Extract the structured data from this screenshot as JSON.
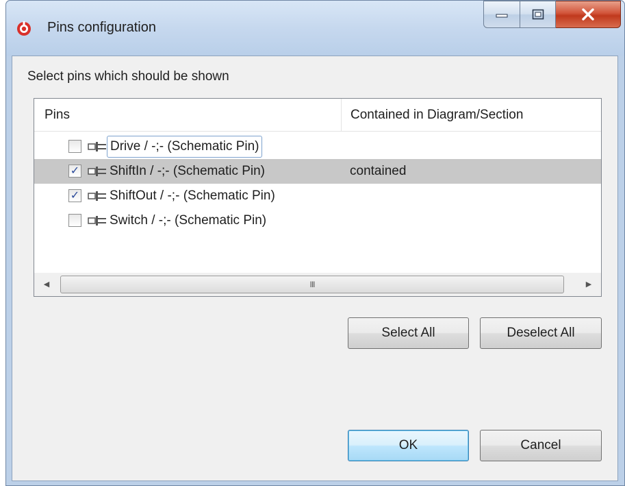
{
  "window": {
    "title": "Pins configuration"
  },
  "dialog": {
    "prompt": "Select pins which should be shown"
  },
  "table": {
    "columns": [
      "Pins",
      "Contained in Diagram/Section"
    ],
    "rows": [
      {
        "checked": false,
        "label": "Drive / -;- (Schematic Pin)",
        "contained": "",
        "selected": false,
        "focused": true
      },
      {
        "checked": true,
        "label": "ShiftIn / -;- (Schematic Pin)",
        "contained": "contained",
        "selected": true,
        "focused": false
      },
      {
        "checked": true,
        "label": "ShiftOut / -;- (Schematic Pin)",
        "contained": "",
        "selected": false,
        "focused": false
      },
      {
        "checked": false,
        "label": "Switch / -;- (Schematic Pin)",
        "contained": "",
        "selected": false,
        "focused": false
      }
    ],
    "checkmark": "✓"
  },
  "scrollbar": {
    "left_arrow": "◀",
    "right_arrow": "▶",
    "grip": "III"
  },
  "buttons": {
    "select_all": "Select All",
    "deselect_all": "Deselect All",
    "ok": "OK",
    "cancel": "Cancel"
  },
  "icons": {
    "app": "app-logo-icon",
    "pin": "schematic-pin-icon",
    "minimize": "minimize-icon",
    "maximize": "maximize-icon",
    "close": "close-icon"
  },
  "colors": {
    "selected_row": "#c8c8c8",
    "title_bar": "#c6d8ee",
    "close_button": "#c0391d",
    "default_button": "#bee6fd",
    "checkmark": "#2a4a9a"
  }
}
